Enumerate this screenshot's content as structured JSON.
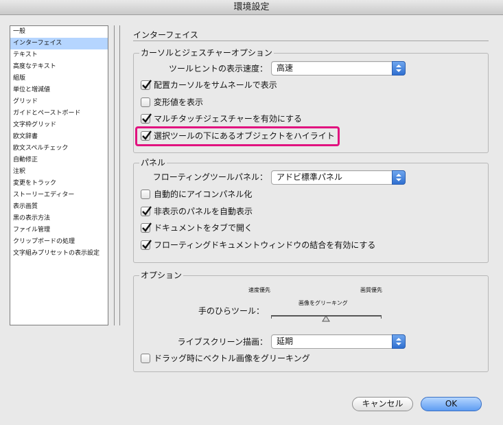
{
  "window": {
    "title": "環境設定"
  },
  "sidebar": {
    "items": [
      {
        "label": "一般"
      },
      {
        "label": "インターフェイス",
        "selected": true
      },
      {
        "label": "テキスト"
      },
      {
        "label": "高度なテキスト"
      },
      {
        "label": "組版"
      },
      {
        "label": "単位と増減値"
      },
      {
        "label": "グリッド"
      },
      {
        "label": "ガイドとペーストボード"
      },
      {
        "label": "文字枠グリッド"
      },
      {
        "label": "欧文辞書"
      },
      {
        "label": "欧文スペルチェック"
      },
      {
        "label": "自動修正"
      },
      {
        "label": "注釈"
      },
      {
        "label": "変更をトラック"
      },
      {
        "label": "ストーリーエディター"
      },
      {
        "label": "表示画質"
      },
      {
        "label": "黒の表示方法"
      },
      {
        "label": "ファイル管理"
      },
      {
        "label": "クリップボードの処理"
      },
      {
        "label": "文字組みプリセットの表示設定"
      }
    ]
  },
  "main": {
    "title": "インターフェイス",
    "cursor_group": {
      "label": "カーソルとジェスチャーオプション",
      "tooltip_label": "ツールヒントの表示速度：",
      "tooltip_value": "高速",
      "checks": [
        {
          "label": "配置カーソルをサムネールで表示",
          "checked": true
        },
        {
          "label": "変形値を表示",
          "checked": false
        },
        {
          "label": "マルチタッチジェスチャーを有効にする",
          "checked": true
        },
        {
          "label": "選択ツールの下にあるオブジェクトをハイライト",
          "checked": true,
          "highlighted": true
        }
      ]
    },
    "panel_group": {
      "label": "パネル",
      "floating_label": "フローティングツールパネル：",
      "floating_value": "アドビ標準パネル",
      "checks": [
        {
          "label": "自動的にアイコンパネル化",
          "checked": false
        },
        {
          "label": "非表示のパネルを自動表示",
          "checked": true
        },
        {
          "label": "ドキュメントをタブで開く",
          "checked": true
        },
        {
          "label": "フローティングドキュメントウィンドウの結合を有効にする",
          "checked": true
        }
      ]
    },
    "options_group": {
      "label": "オプション",
      "hand_tool_label": "手のひらツール：",
      "slider_left": "速度優先",
      "slider_right": "画質優先",
      "slider_center": "画像をグリーキング",
      "slider_value": 0.5,
      "live_label": "ライブスクリーン描画：",
      "live_value": "延期",
      "greek_vector": {
        "label": "ドラッグ時にベクトル画像をグリーキング",
        "checked": false
      }
    }
  },
  "buttons": {
    "cancel": "キャンセル",
    "ok": "OK"
  },
  "colors": {
    "highlight": "#e1127f",
    "selection": "#b5d5ff",
    "accent": "#3a7ee0"
  }
}
